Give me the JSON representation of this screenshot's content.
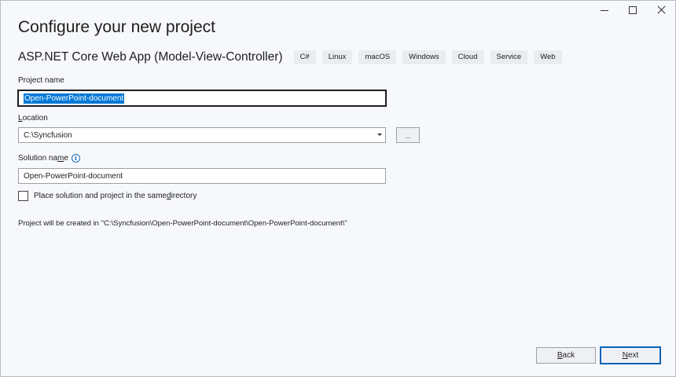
{
  "window": {
    "controls": [
      "minimize",
      "maximize",
      "close"
    ]
  },
  "page": {
    "title": "Configure your new project"
  },
  "template": {
    "name": "ASP.NET Core Web App (Model-View-Controller)",
    "tags": [
      "C#",
      "Linux",
      "macOS",
      "Windows",
      "Cloud",
      "Service",
      "Web"
    ]
  },
  "project_name": {
    "label": "Project name",
    "value": "Open-PowerPoint-document"
  },
  "location": {
    "label_first": "L",
    "label_rest": "ocation",
    "value": "C:\\Syncfusion",
    "browse_label": "..."
  },
  "solution_name": {
    "label_start": "Solution na",
    "label_underlined": "m",
    "label_end": "e",
    "value": "Open-PowerPoint-document",
    "info_icon": "info-icon"
  },
  "same_directory": {
    "label_start": "Place solution and project in the same ",
    "label_underlined": "d",
    "label_end": "irectory",
    "checked": false
  },
  "summary": {
    "text": "Project will be created in \"C:\\Syncfusion\\Open-PowerPoint-document\\Open-PowerPoint-document\\\""
  },
  "footer": {
    "back_first": "B",
    "back_rest": "ack",
    "next_first": "N",
    "next_rest": "ext"
  },
  "colors": {
    "accent": "#0078d7",
    "background": "#f6f8fb",
    "tag_background": "#e9ecf1"
  }
}
